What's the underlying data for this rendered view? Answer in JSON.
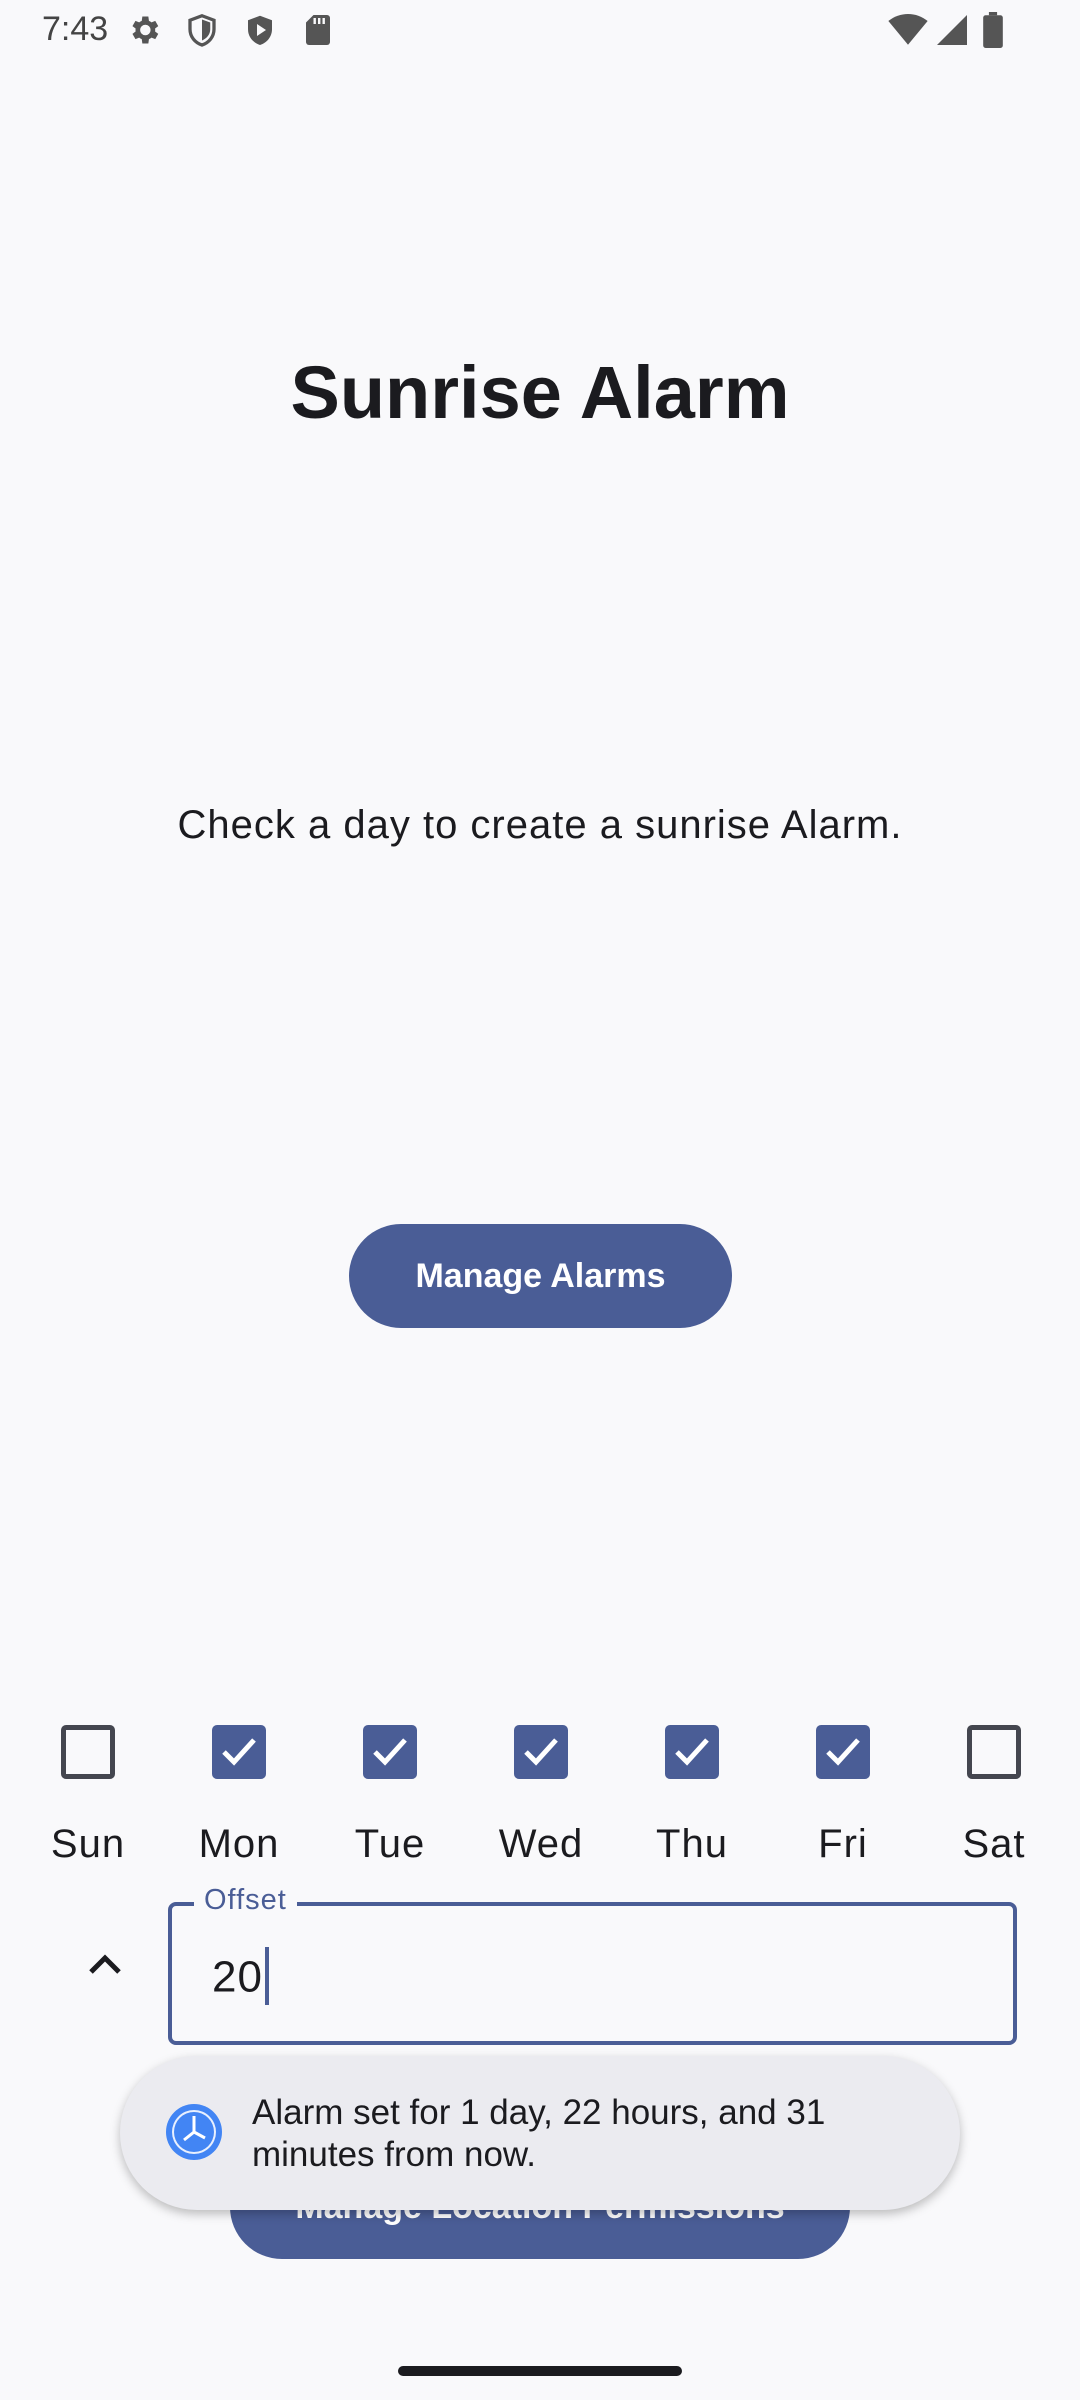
{
  "status_bar": {
    "time": "7:43",
    "left_icons": [
      "gear-icon",
      "shield-outline-icon",
      "shield-filled-icon",
      "sd-card-icon"
    ],
    "right_icons": [
      "wifi-icon",
      "signal-icon",
      "battery-icon"
    ]
  },
  "app": {
    "title": "Sunrise Alarm",
    "instruction": "Check a day to create a sunrise Alarm.",
    "manage_alarms_label": "Manage Alarms",
    "manage_location_label": "Manage Location Permissions"
  },
  "days": [
    {
      "label": "Sun",
      "checked": false
    },
    {
      "label": "Mon",
      "checked": true
    },
    {
      "label": "Tue",
      "checked": true
    },
    {
      "label": "Wed",
      "checked": true
    },
    {
      "label": "Thu",
      "checked": true
    },
    {
      "label": "Fri",
      "checked": true
    },
    {
      "label": "Sat",
      "checked": false
    }
  ],
  "offset": {
    "label": "Offset",
    "value": "20"
  },
  "toast": {
    "icon": "clock-icon",
    "message": "Alarm set for 1 day, 22 hours, and 31 minutes from now."
  },
  "colors": {
    "primary": "#4a5d96",
    "background": "#f9f9fb",
    "toast_background": "#ebebf0",
    "text": "#1b1b1f"
  }
}
